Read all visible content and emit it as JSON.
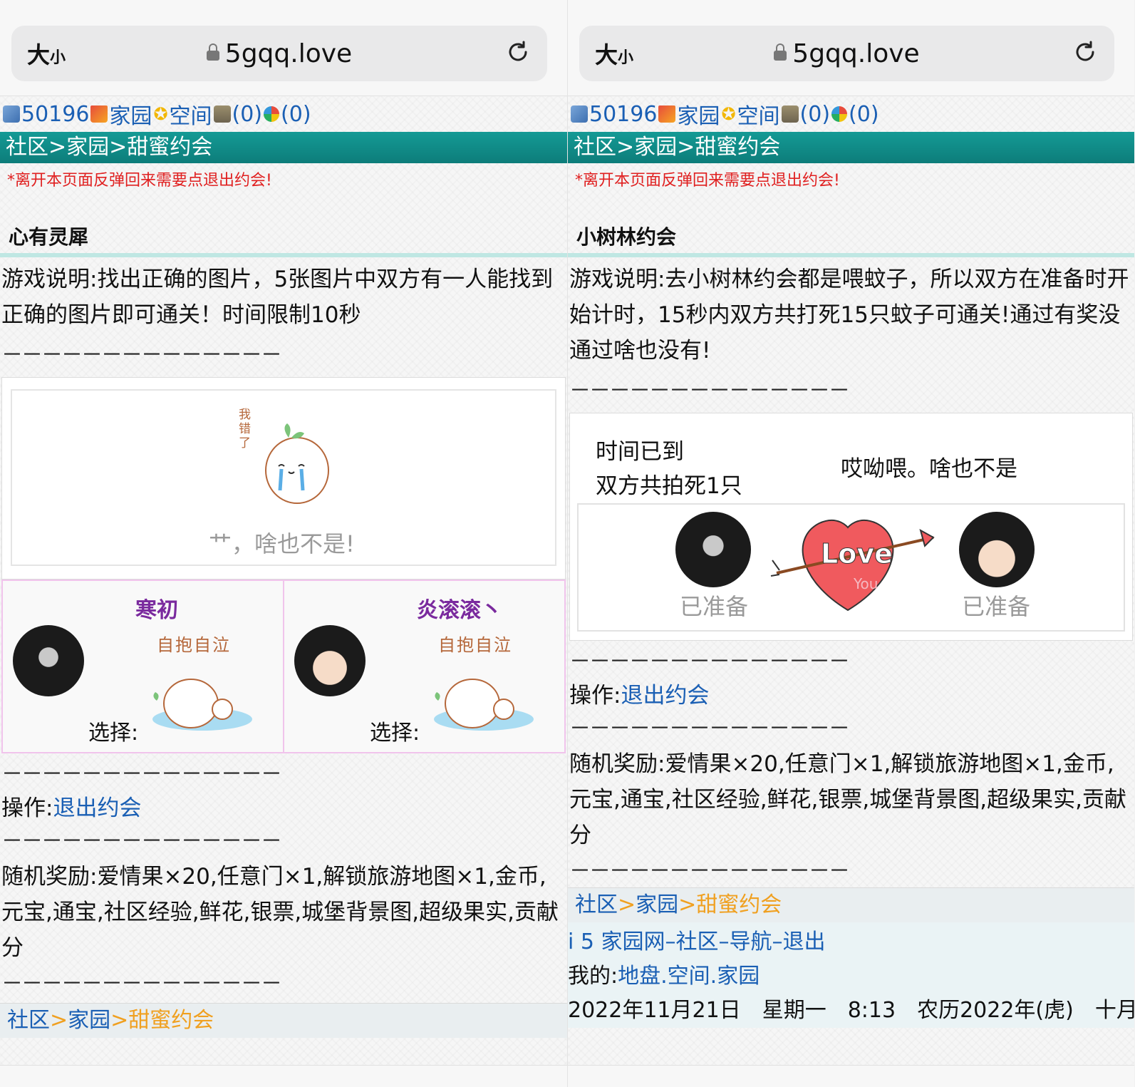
{
  "left": {
    "browser": {
      "size_label": "大",
      "size_small": "小",
      "domain": "5gqq.love"
    },
    "stats": {
      "user_id": "50196",
      "home": "家园",
      "space": "空间",
      "bank": "(0)",
      "ring": "(0)"
    },
    "breadcrumb": "社区>家园>甜蜜约会",
    "notice": "*离开本页面反弹回来需要点退出约会!",
    "game_title": "心有灵犀",
    "description": "游戏说明:找出正确的图片，5张图片中双方有一人能找到正确的图片即可通关！时间限制10秒",
    "dashes": "－－－－－－－－－－－－－－",
    "result_sticker_text": "我错了",
    "result_text": "艹，啥也不是!",
    "players": [
      {
        "name": "寒初",
        "sticker": "自抱自泣",
        "choice_label": "选择:"
      },
      {
        "name": "炎滚滚丶",
        "sticker": "自抱自泣",
        "choice_label": "选择:"
      }
    ],
    "operation_label": "操作:",
    "exit_link": "退出约会",
    "reward": "随机奖励:爱情果×20,任意门×1,解锁旅游地图×1,金币,元宝,通宝,社区经验,鲜花,银票,城堡背景图,超级果实,贡献分",
    "footer_crumb": {
      "a": "社区",
      "b": "家园",
      "c": "甜蜜约会",
      "sep": ">"
    }
  },
  "right": {
    "browser": {
      "size_label": "大",
      "size_small": "小",
      "domain": "5gqq.love"
    },
    "stats": {
      "user_id": "50196",
      "home": "家园",
      "space": "空间",
      "bank": "(0)",
      "ring": "(0)"
    },
    "breadcrumb": "社区>家园>甜蜜约会",
    "notice": "*离开本页面反弹回来需要点退出约会!",
    "game_title": "小树林约会",
    "description": "游戏说明:去小树林约会都是喂蚊子，所以双方在准备时开始计时，15秒内双方共打死15只蚊子可通关!通过有奖没通过啥也没有!",
    "dashes": "－－－－－－－－－－－－－－",
    "time_up": "时间已到",
    "kills": "双方共拍死1只",
    "verdict": "哎呦喂。啥也不是",
    "ready_left": "已准备",
    "ready_right": "已准备",
    "love_text": "Love",
    "love_small": "You",
    "operation_label": "操作:",
    "exit_link": "退出约会",
    "reward": "随机奖励:爱情果×20,任意门×1,解锁旅游地图×1,金币,元宝,通宝,社区经验,鲜花,银票,城堡背景图,超级果实,贡献分",
    "footer_crumb": {
      "a": "社区",
      "b": "家园",
      "c": "甜蜜约会",
      "sep": ">"
    },
    "footer_nav": {
      "site": "i 5 家园网",
      "community": "社区",
      "nav": "导航",
      "exit": "退出",
      "sep": "–"
    },
    "my_label": "我的:",
    "my_links": {
      "turf": "地盘",
      "space": "空间",
      "home": "家园",
      "dot": "."
    },
    "datetime": "2022年11月21日　星期一　8:13　农历2022年(虎)　十月"
  }
}
